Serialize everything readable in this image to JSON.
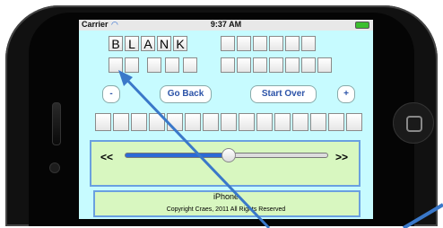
{
  "status_bar": {
    "carrier": "Carrier",
    "time": "9:37 AM"
  },
  "word_row_1": {
    "letters": [
      "B",
      "L",
      "A",
      "N",
      "K"
    ]
  },
  "buttons": {
    "minus": "-",
    "go_back": "Go Back",
    "start_over": "Start Over",
    "plus": "+"
  },
  "slider": {
    "left_label": "<<",
    "right_label": ">>",
    "level": 0.51
  },
  "footer": {
    "device": "iPhone",
    "copyright": "Copyright Craes, 2011 All Rights Reserved"
  },
  "colors": {
    "screen_bg": "#c7fbff",
    "panel_bg": "#d8f7c0",
    "panel_border": "#6aa0e0",
    "button_text": "#2c53a8",
    "arrow": "#3a78c9"
  }
}
